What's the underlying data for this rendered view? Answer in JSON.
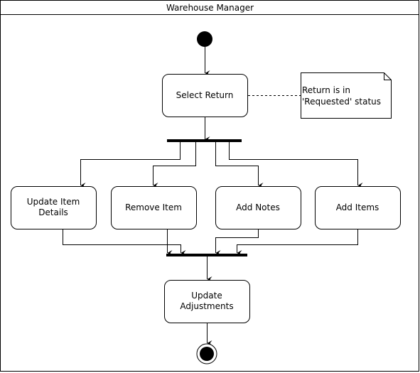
{
  "swimlane": {
    "title": "Warehouse Manager"
  },
  "nodes": {
    "start": {
      "type": "initial"
    },
    "select_return": {
      "label": "Select Return"
    },
    "update_item_details": {
      "label": "Update Item Details"
    },
    "remove_item": {
      "label": "Remove Item"
    },
    "add_notes": {
      "label": "Add Notes"
    },
    "add_items": {
      "label": "Add Items"
    },
    "update_adjustments": {
      "label": "Update Adjustments"
    },
    "end": {
      "type": "final"
    }
  },
  "note": {
    "text_line1": "Return is in",
    "text_line2": "'Requested' status",
    "attached_to": "select_return"
  },
  "edges": [
    {
      "from": "start",
      "to": "select_return"
    },
    {
      "from": "select_return",
      "to": "fork"
    },
    {
      "from": "fork",
      "to": "update_item_details"
    },
    {
      "from": "fork",
      "to": "remove_item"
    },
    {
      "from": "fork",
      "to": "add_notes"
    },
    {
      "from": "fork",
      "to": "add_items"
    },
    {
      "from": "update_item_details",
      "to": "join"
    },
    {
      "from": "remove_item",
      "to": "join"
    },
    {
      "from": "add_notes",
      "to": "join"
    },
    {
      "from": "add_items",
      "to": "join"
    },
    {
      "from": "join",
      "to": "update_adjustments"
    },
    {
      "from": "update_adjustments",
      "to": "end"
    }
  ]
}
